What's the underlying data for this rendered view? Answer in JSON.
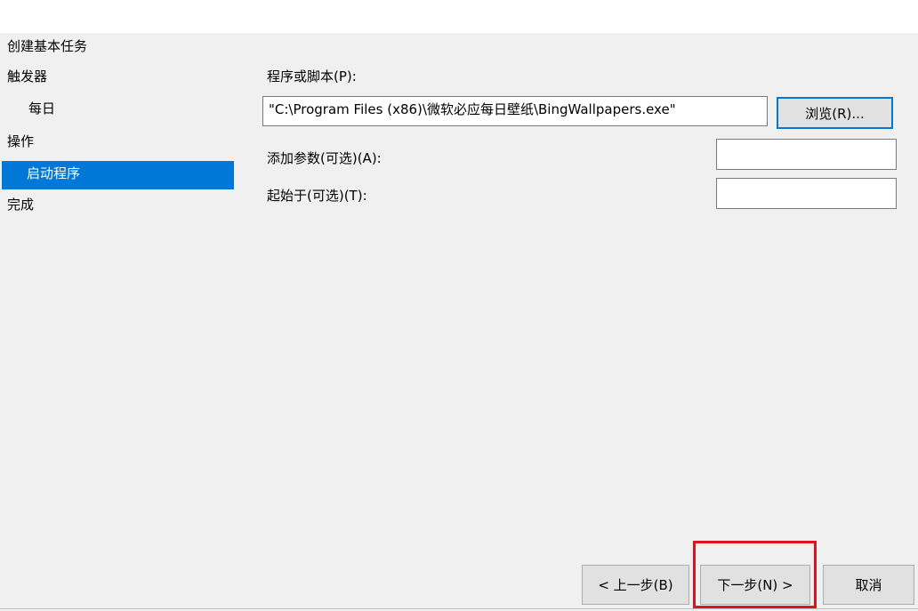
{
  "wizard": {
    "title": "创建基本任务",
    "steps": [
      {
        "label": "触发器"
      },
      {
        "label": "每日"
      },
      {
        "label": "操作"
      },
      {
        "label": "启动程序"
      },
      {
        "label": "完成"
      }
    ]
  },
  "form": {
    "program_label": "程序或脚本(P):",
    "program_value": "\"C:\\Program Files (x86)\\微软必应每日壁纸\\BingWallpapers.exe\"",
    "browse_button": "浏览(R)...",
    "arguments_label": "添加参数(可选)(A):",
    "arguments_value": "",
    "start_in_label": "起始于(可选)(T):",
    "start_in_value": ""
  },
  "footer": {
    "back_button": "< 上一步(B)",
    "next_button": "下一步(N) >",
    "cancel_button": "取消"
  },
  "colors": {
    "selected_step": "#0078d7",
    "highlight": "#e0141e",
    "panel": "#f0f0f0"
  }
}
